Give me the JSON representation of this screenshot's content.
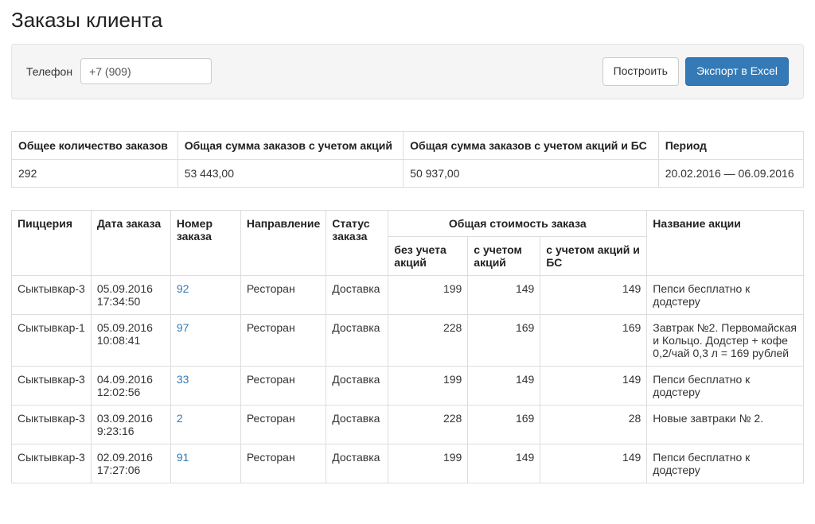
{
  "page_title": "Заказы клиента",
  "filter": {
    "phone_label": "Телефон",
    "phone_value": "+7 (909)",
    "build_label": "Построить",
    "export_label": "Экспорт в Excel"
  },
  "summary": {
    "headers": {
      "total_count": "Общее количество заказов",
      "total_with_promo": "Общая сумма заказов с учетом акций",
      "total_with_promo_bs": "Общая сумма заказов с учетом акций и БС",
      "period": "Период"
    },
    "values": {
      "total_count": "292",
      "total_with_promo": "53 443,00",
      "total_with_promo_bs": "50 937,00",
      "period": "20.02.2016 — 06.09.2016"
    }
  },
  "orders_table": {
    "headers": {
      "pizzeria": "Пиццерия",
      "order_date": "Дата заказа",
      "order_number": "Номер заказа",
      "direction": "Направление",
      "status": "Статус заказа",
      "cost_group": "Общая стоимость заказа",
      "cost_no_promo": "без учета акций",
      "cost_with_promo": "с учетом акций",
      "cost_with_promo_bs": "с учетом акций и БС",
      "promo_name": "Название акции"
    },
    "rows": [
      {
        "pizzeria": "Сыктывкар-3",
        "date": "05.09.2016 17:34:50",
        "number": "92",
        "direction": "Ресторан",
        "status": "Доставка",
        "cost_no_promo": "199",
        "cost_with_promo": "149",
        "cost_with_promo_bs": "149",
        "promo": "Пепси бесплатно к додстеру"
      },
      {
        "pizzeria": "Сыктывкар-1",
        "date": "05.09.2016 10:08:41",
        "number": "97",
        "direction": "Ресторан",
        "status": "Доставка",
        "cost_no_promo": "228",
        "cost_with_promo": "169",
        "cost_with_promo_bs": "169",
        "promo": "Завтрак №2. Первомайская и Кольцо. Додстер + кофе 0,2/чай 0,3 л = 169 рублей"
      },
      {
        "pizzeria": "Сыктывкар-3",
        "date": "04.09.2016 12:02:56",
        "number": "33",
        "direction": "Ресторан",
        "status": "Доставка",
        "cost_no_promo": "199",
        "cost_with_promo": "149",
        "cost_with_promo_bs": "149",
        "promo": "Пепси бесплатно к додстеру"
      },
      {
        "pizzeria": "Сыктывкар-3",
        "date": "03.09.2016 9:23:16",
        "number": "2",
        "direction": "Ресторан",
        "status": "Доставка",
        "cost_no_promo": "228",
        "cost_with_promo": "169",
        "cost_with_promo_bs": "28",
        "promo": "Новые завтраки № 2."
      },
      {
        "pizzeria": "Сыктывкар-3",
        "date": "02.09.2016 17:27:06",
        "number": "91",
        "direction": "Ресторан",
        "status": "Доставка",
        "cost_no_promo": "199",
        "cost_with_promo": "149",
        "cost_with_promo_bs": "149",
        "promo": "Пепси бесплатно к додстеру"
      }
    ]
  }
}
